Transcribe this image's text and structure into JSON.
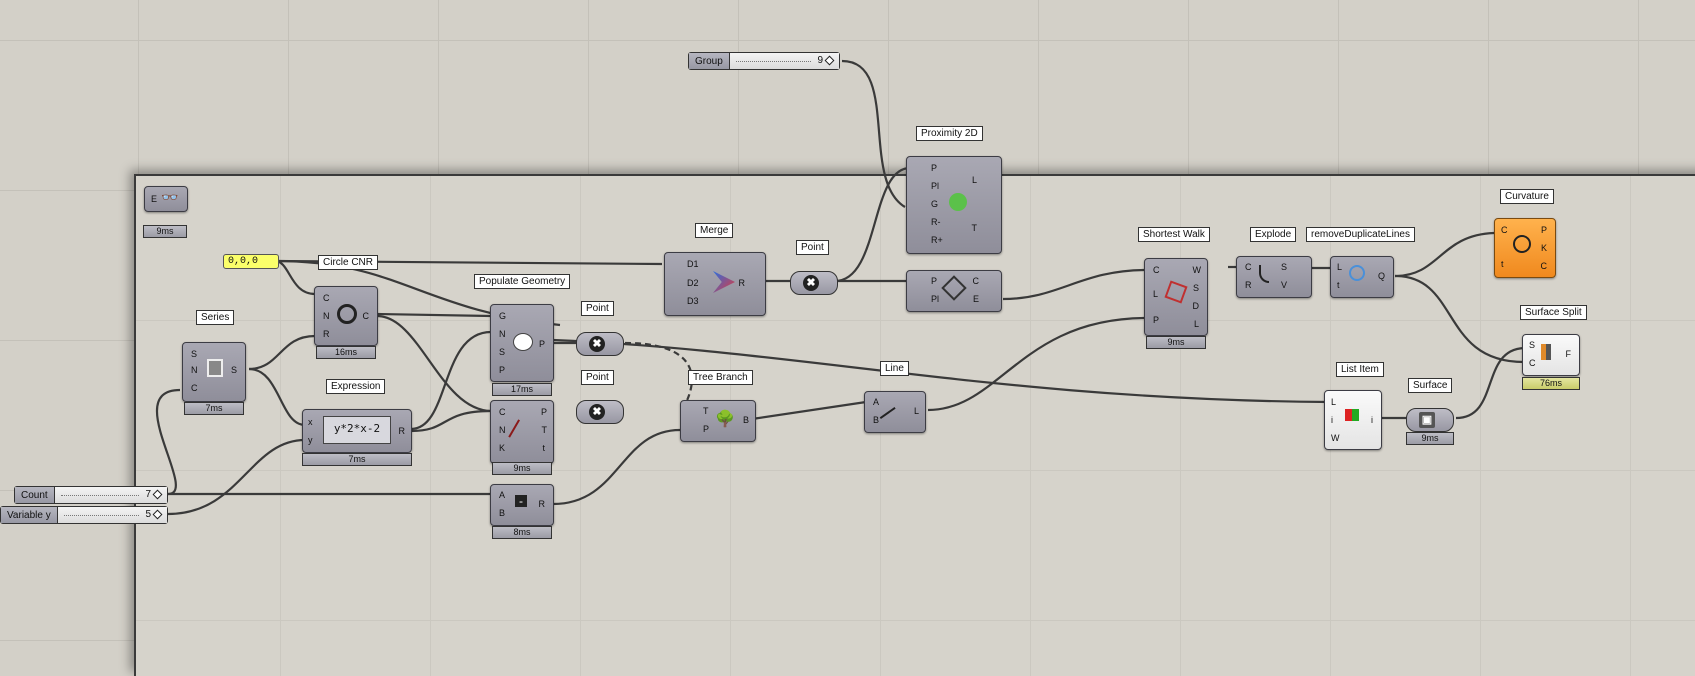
{
  "canvas": {
    "colors": {
      "background": "#d3d0c8",
      "group": "#d6d3cb",
      "component": "#9c9ba7",
      "accent_orange": "#f59a2c",
      "panel_yellow": "#fbff6a"
    }
  },
  "sliders": {
    "group": {
      "name": "Group",
      "value": "9"
    },
    "count": {
      "name": "Count",
      "value": "7"
    },
    "variable_y": {
      "name": "Variable y",
      "value": "5"
    }
  },
  "panel": {
    "text": "0,0,0"
  },
  "top_left": {
    "label": "E",
    "ms": "9ms"
  },
  "components": {
    "series": {
      "label": "Series",
      "inputs": [
        "S",
        "N",
        "C"
      ],
      "outputs": [
        "S"
      ],
      "ms": "7ms"
    },
    "circle": {
      "label": "Circle CNR",
      "inputs": [
        "C",
        "N",
        "R"
      ],
      "outputs": [
        "C"
      ],
      "ms": "16ms"
    },
    "expression": {
      "label": "Expression",
      "inputs": [
        "x",
        "y"
      ],
      "outputs": [
        "R"
      ],
      "formula": "y*2*x-2",
      "ms": "7ms"
    },
    "populate": {
      "label": "Populate Geometry",
      "inputs": [
        "G",
        "N",
        "S",
        "P"
      ],
      "outputs": [
        "P"
      ],
      "ms": "17ms"
    },
    "curve": {
      "inputs": [
        "C",
        "N",
        "K"
      ],
      "outputs": [
        "P",
        "T",
        "t"
      ],
      "ms": "9ms"
    },
    "subtract": {
      "inputs": [
        "A",
        "B"
      ],
      "outputs": [
        "R"
      ],
      "ms": "8ms"
    },
    "point1": {
      "label": "Point"
    },
    "point2": {
      "label": "Point"
    },
    "point3": {
      "label": "Point"
    },
    "merge": {
      "label": "Merge",
      "inputs": [
        "D1",
        "D2",
        "D3"
      ],
      "outputs": [
        "R"
      ]
    },
    "tree_branch": {
      "label": "Tree Branch",
      "inputs": [
        "T",
        "P"
      ],
      "outputs": [
        "B"
      ]
    },
    "line": {
      "label": "Line",
      "inputs": [
        "A",
        "B"
      ],
      "outputs": [
        "L"
      ]
    },
    "proximity": {
      "label": "Proximity 2D",
      "inputs": [
        "P",
        "Pl",
        "G",
        "R-",
        "R+"
      ],
      "outputs": [
        "L",
        "T"
      ]
    },
    "delaunay": {
      "inputs": [
        "P",
        "Pl"
      ],
      "outputs": [
        "C",
        "E"
      ]
    },
    "shortest_walk": {
      "label": "Shortest Walk",
      "inputs": [
        "C",
        "L",
        "P"
      ],
      "outputs": [
        "W",
        "S",
        "D",
        "L"
      ],
      "ms": "9ms"
    },
    "explode": {
      "label": "Explode",
      "inputs": [
        "C",
        "R"
      ],
      "outputs": [
        "S",
        "V"
      ]
    },
    "remove_dup": {
      "label": "removeDuplicateLines",
      "inputs": [
        "L",
        "t"
      ],
      "outputs": [
        "Q"
      ]
    },
    "curvature": {
      "label": "Curvature",
      "inputs": [
        "C",
        "t"
      ],
      "outputs": [
        "P",
        "K",
        "C"
      ]
    },
    "surface_split": {
      "label": "Surface Split",
      "inputs": [
        "S",
        "C"
      ],
      "outputs": [
        "F"
      ],
      "ms": "76ms"
    },
    "list_item": {
      "label": "List Item",
      "inputs": [
        "L",
        "i",
        "W"
      ],
      "outputs": [
        "i"
      ]
    },
    "surface": {
      "label": "Surface",
      "ms": "9ms"
    }
  }
}
